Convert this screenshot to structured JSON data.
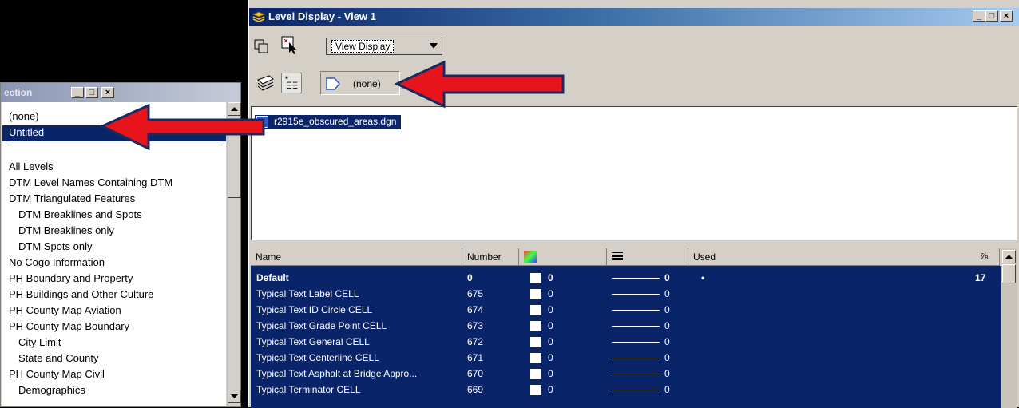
{
  "main_window": {
    "title": "Level Display - View 1",
    "title_buttons": [
      "_",
      "□",
      "×"
    ],
    "view_dropdown": {
      "value": "View Display"
    },
    "filter_selector": {
      "value": "(none)"
    },
    "file_list": [
      {
        "name": "r2915e_obscured_areas.dgn",
        "selected": true
      }
    ],
    "grid": {
      "headers": {
        "name": "Name",
        "number": "Number",
        "used": "Used"
      },
      "rows": [
        {
          "name": "Default",
          "number": "0",
          "color": "0",
          "weight": "0",
          "used": "•",
          "extra": "17",
          "bold": true
        },
        {
          "name": "Typical Text Label CELL",
          "number": "675",
          "color": "0",
          "weight": "0"
        },
        {
          "name": "Typical Text ID Circle CELL",
          "number": "674",
          "color": "0",
          "weight": "0"
        },
        {
          "name": "Typical Text Grade Point CELL",
          "number": "673",
          "color": "0",
          "weight": "0"
        },
        {
          "name": "Typical Text General CELL",
          "number": "672",
          "color": "0",
          "weight": "0"
        },
        {
          "name": "Typical Text Centerline CELL",
          "number": "671",
          "color": "0",
          "weight": "0"
        },
        {
          "name": "Typical Text Asphalt at Bridge Appro...",
          "number": "670",
          "color": "0",
          "weight": "0"
        },
        {
          "name": "Typical Terminator CELL",
          "number": "669",
          "color": "0",
          "weight": "0"
        }
      ]
    }
  },
  "filter_window": {
    "title": "ection",
    "title_buttons": [
      "_",
      "□",
      "×"
    ],
    "items": [
      {
        "label": "(none)"
      },
      {
        "label": "Untitled",
        "selected": true
      },
      {
        "label": "All Levels"
      },
      {
        "label": "DTM Level Names Containing DTM"
      },
      {
        "label": "DTM Triangulated Features"
      },
      {
        "label": "DTM Breaklines and Spots",
        "indent": true
      },
      {
        "label": "DTM Breaklines only",
        "indent": true
      },
      {
        "label": "DTM Spots only",
        "indent": true
      },
      {
        "label": "No Cogo Information"
      },
      {
        "label": "PH Boundary and Property"
      },
      {
        "label": "PH Buildings and Other Culture"
      },
      {
        "label": "PH County Map Aviation"
      },
      {
        "label": "PH County Map Boundary"
      },
      {
        "label": "City Limit",
        "indent": true
      },
      {
        "label": "State and County",
        "indent": true
      },
      {
        "label": "PH County Map Civil"
      },
      {
        "label": "Demographics",
        "indent": true
      }
    ]
  },
  "colors": {
    "selection": "#0a246a",
    "arrow": "#e8141b",
    "chrome": "#d4d0c8"
  }
}
